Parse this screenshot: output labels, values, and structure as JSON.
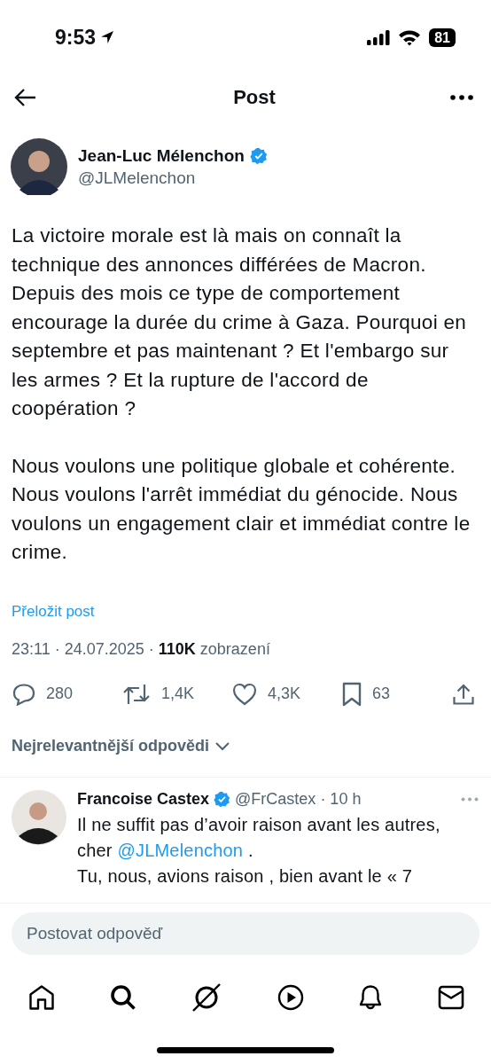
{
  "status_bar": {
    "time": "9:53",
    "battery": "81"
  },
  "header": {
    "title": "Post"
  },
  "author": {
    "name": "Jean-Luc Mélenchon",
    "handle": "@JLMelenchon",
    "verified": true
  },
  "post": {
    "paragraphs": [
      "La victoire morale est là mais on connaît la technique des annonces différées de Macron. Depuis des mois ce type de comportement encourage la durée du crime à Gaza. Pourquoi en septembre et pas maintenant ? Et l'embargo sur les armes ? Et la rupture de l'accord de coopération ?",
      "Nous voulons une politique globale et cohérente. Nous voulons l'arrêt immédiat du génocide. Nous voulons un engagement clair et immédiat contre le crime."
    ],
    "translate": "Přeložit post",
    "time": "23:11 · 24.07.2025 ·",
    "views": "110K",
    "views_label": "zobrazení"
  },
  "actions": [
    {
      "kind": "reply",
      "count": "280"
    },
    {
      "kind": "repost",
      "count": "1,4K"
    },
    {
      "kind": "like",
      "count": "4,3K"
    },
    {
      "kind": "bookmark",
      "count": "63"
    },
    {
      "kind": "share"
    }
  ],
  "sort": {
    "label": "Nejrelevantnější odpovědi"
  },
  "replies": [
    {
      "name": "Francoise Castex",
      "verified": true,
      "handle": "@FrCastex",
      "time": "· 10 h",
      "parts": [
        {
          "kind": "text",
          "text": "Il ne suffit pas d’avoir raison avant les autres, cher "
        },
        {
          "kind": "link",
          "text": "@JLMelenchon"
        },
        {
          "kind": "text",
          "text": " ."
        },
        {
          "kind": "break"
        },
        {
          "kind": "text",
          "text": "Tu, nous, avions raison , bien avant le « 7"
        }
      ]
    }
  ],
  "composer": {
    "placeholder": "Postovat odpověď"
  },
  "tab_bar": [
    {
      "kind": "home"
    },
    {
      "kind": "search"
    },
    {
      "kind": "grok"
    },
    {
      "kind": "video"
    },
    {
      "kind": "notifications"
    },
    {
      "kind": "messages"
    }
  ]
}
